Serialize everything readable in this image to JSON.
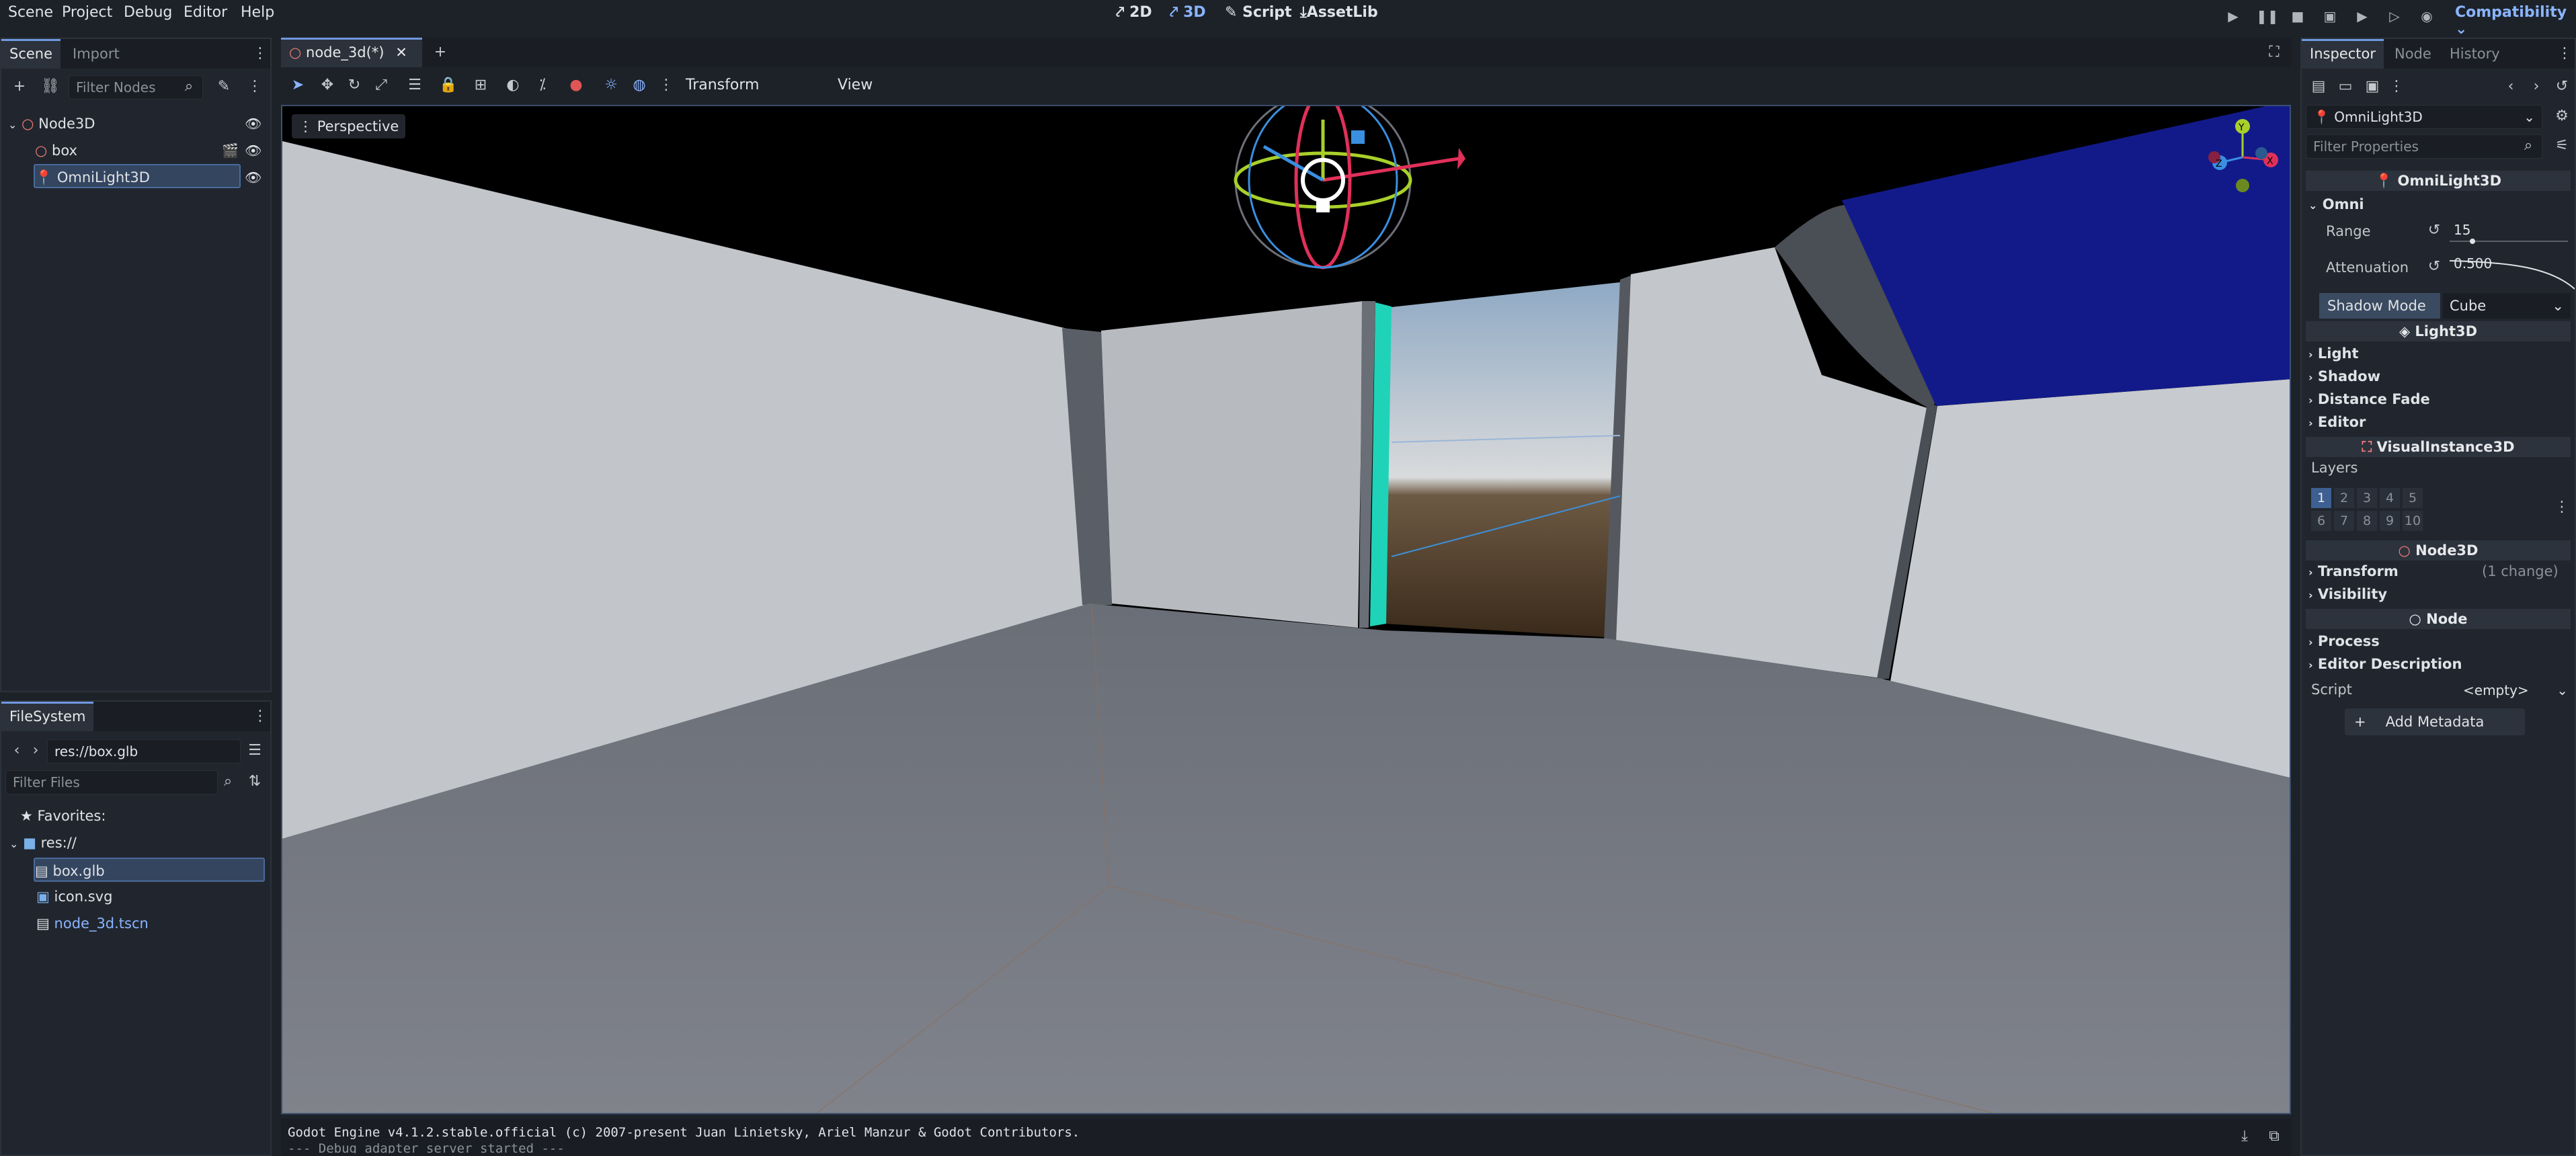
{
  "menu": {
    "scene": "Scene",
    "project": "Project",
    "debug": "Debug",
    "editor": "Editor",
    "help": "Help"
  },
  "workspaces": {
    "w2d": "2D",
    "w3d": "3D",
    "script": "Script",
    "assetlib": "AssetLib"
  },
  "renderer": "Compatibility",
  "scene_dock": {
    "tabs": [
      "Scene",
      "Import"
    ],
    "filter_placeholder": "Filter Nodes",
    "nodes": [
      {
        "name": "Node3D"
      },
      {
        "name": "box"
      },
      {
        "name": "OmniLight3D"
      }
    ]
  },
  "filesystem_dock": {
    "tab": "FileSystem",
    "path": "res://box.glb",
    "filter_placeholder": "Filter Files",
    "favorites": "Favorites:",
    "root": "res://",
    "files": [
      "box.glb",
      "icon.svg",
      "node_3d.tscn"
    ]
  },
  "editor_tab": {
    "label": "node_3d(*)"
  },
  "viewport_toolbar": {
    "transform": "Transform",
    "view": "View",
    "perspective": "Perspective"
  },
  "inspector": {
    "tabs": [
      "Inspector",
      "Node",
      "History"
    ],
    "object": "OmniLight3D",
    "filter_placeholder": "Filter Properties",
    "class_omni": "OmniLight3D",
    "omni_group": "Omni",
    "range_label": "Range",
    "range_value": "15",
    "attenuation_label": "Attenuation",
    "attenuation_value": "0.500",
    "shadow_mode_label": "Shadow Mode",
    "shadow_mode_value": "Cube",
    "class_light": "Light3D",
    "light_groups": [
      "Light",
      "Shadow",
      "Distance Fade",
      "Editor"
    ],
    "class_visual": "VisualInstance3D",
    "layers_label": "Layers",
    "layers_row1": [
      "1",
      "2",
      "3",
      "4",
      "5"
    ],
    "layers_row2": [
      "6",
      "7",
      "8",
      "9",
      "10"
    ],
    "class_node3d": "Node3D",
    "transform_label": "Transform",
    "transform_change": "(1 change)",
    "visibility_label": "Visibility",
    "class_node": "Node",
    "process_label": "Process",
    "editor_desc_label": "Editor Description",
    "script_label": "Script",
    "script_value": "<empty>",
    "add_metadata": "Add Metadata"
  },
  "console": {
    "line1": "Godot Engine v4.1.2.stable.official (c) 2007-present Juan Linietsky, Ariel Manzur & Godot Contributors.",
    "line2": "--- Debug adapter server started ---"
  },
  "colors": {
    "accent": "#6f98e0",
    "ceiling": "#000000",
    "wall": "#c6c9cd",
    "floor": "#6f737c",
    "blue_panel": "#121a8a",
    "teal": "#1fd3b8"
  }
}
